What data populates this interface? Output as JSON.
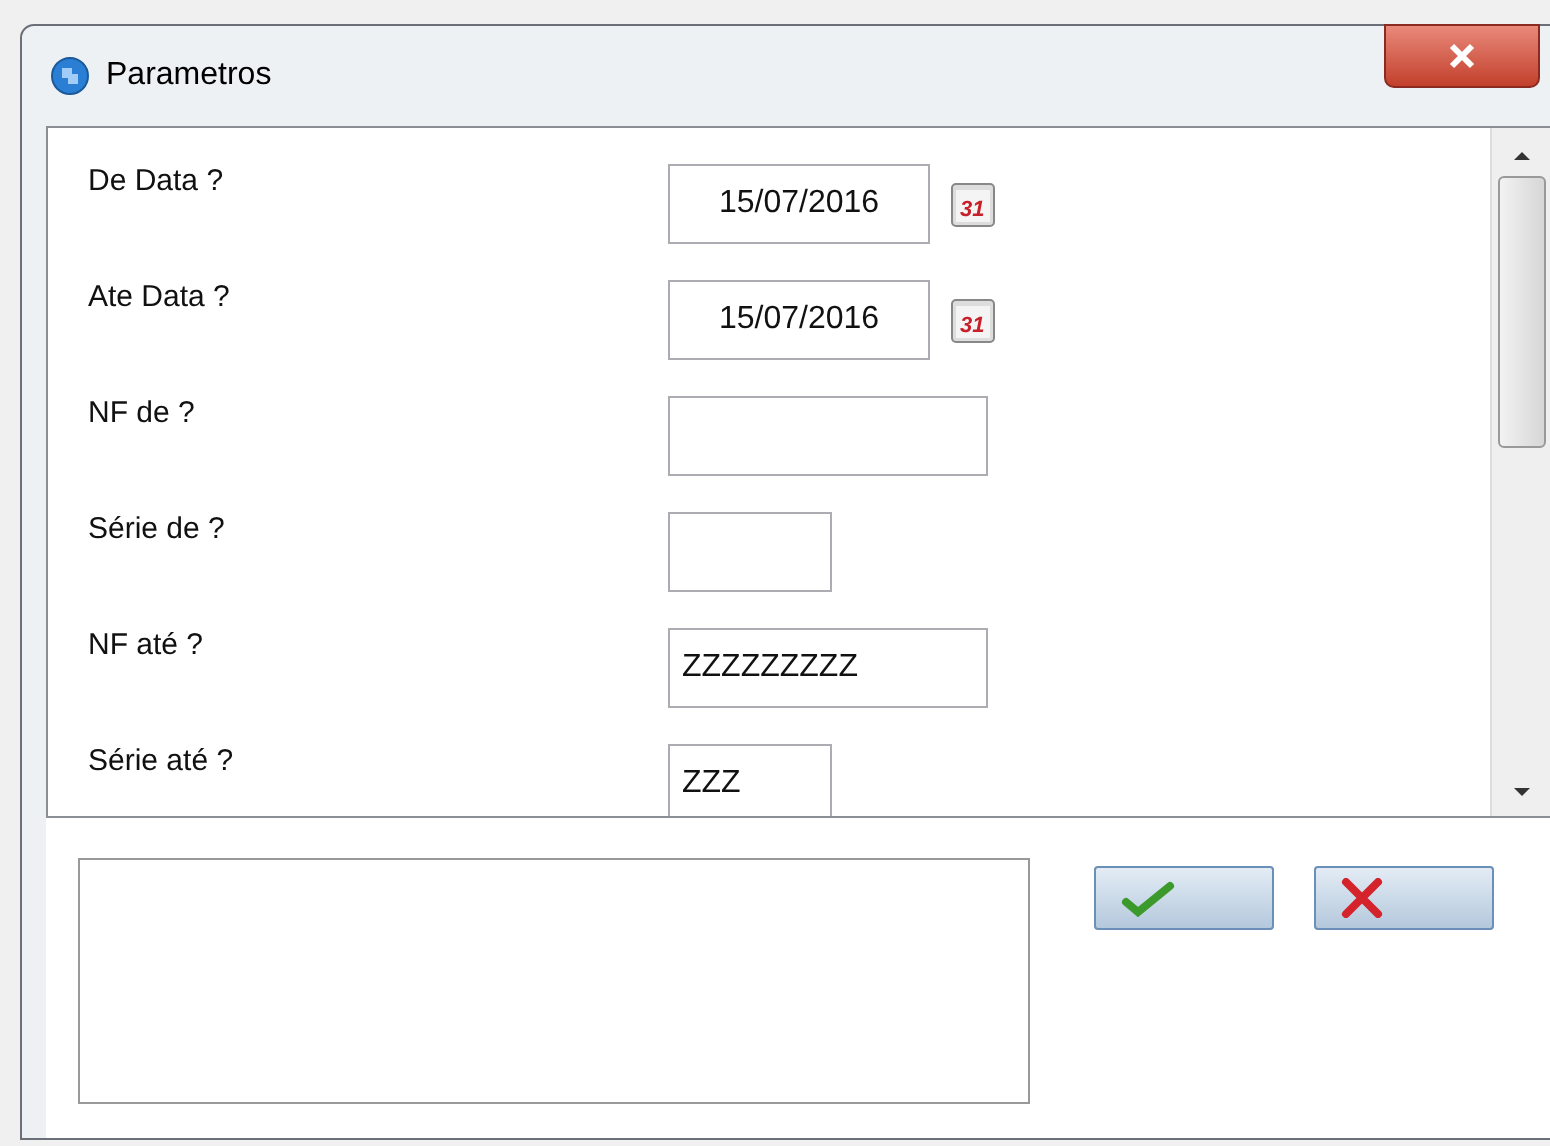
{
  "window": {
    "title": "Parametros"
  },
  "fields": [
    {
      "label": "De Data ?",
      "kind": "date",
      "value": "15/07/2016",
      "calendar_day": "31"
    },
    {
      "label": "Ate Data ?",
      "kind": "date",
      "value": "15/07/2016",
      "calendar_day": "31"
    },
    {
      "label": "NF de ?",
      "kind": "long"
    },
    {
      "label": "Série de ?",
      "kind": "short"
    },
    {
      "label": "NF até ?",
      "kind": "long",
      "value": "ZZZZZZZZZ"
    },
    {
      "label": "Série até ?",
      "kind": "short",
      "value": "ZZZ"
    }
  ]
}
